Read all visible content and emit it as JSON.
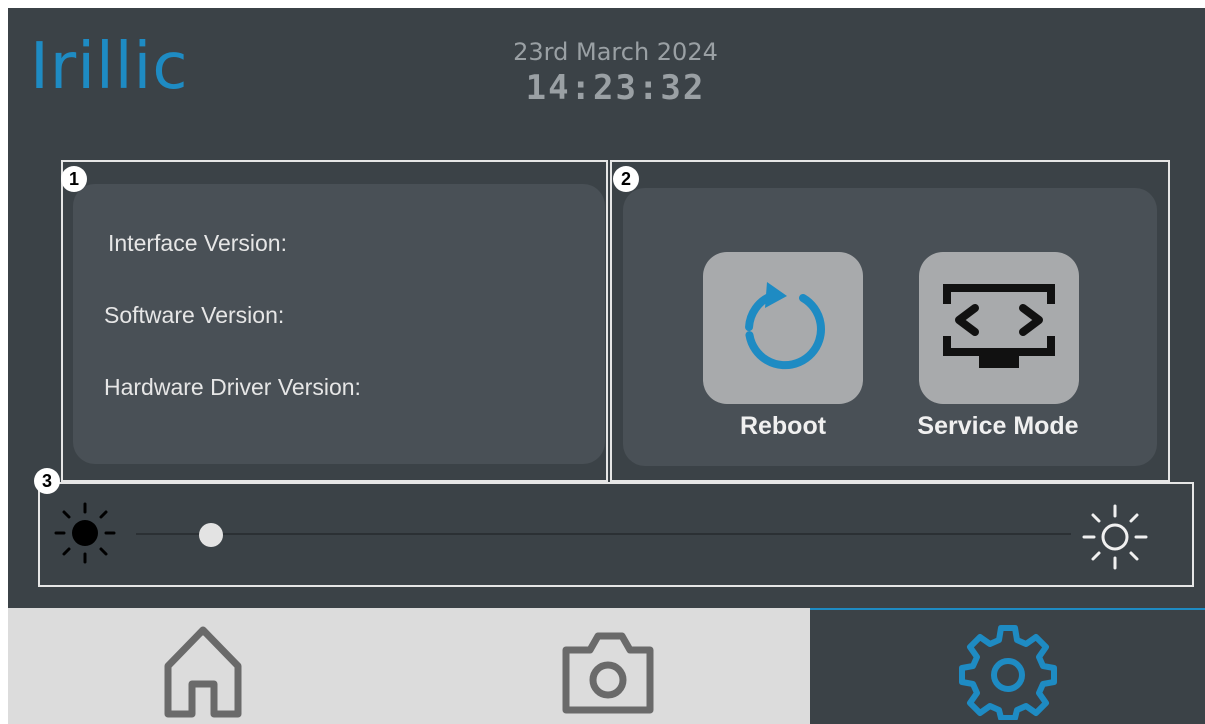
{
  "header": {
    "logo_text": "Irillic",
    "date": "23rd March 2024",
    "time": "14:23:32"
  },
  "sections": {
    "info": {
      "number": "1",
      "labels": [
        "Interface Version:",
        "Software Version:",
        "Hardware Driver Version:"
      ]
    },
    "actions": {
      "number": "2",
      "reboot_label": "Reboot",
      "service_label": "Service Mode",
      "reboot_icon": "reboot-icon",
      "service_icon": "service-mode-icon"
    },
    "brightness": {
      "number": "3",
      "min_icon": "sun-dark-icon",
      "max_icon": "sun-light-icon",
      "level": 0.08
    }
  },
  "nav": {
    "items": [
      {
        "name": "home",
        "icon": "home-icon"
      },
      {
        "name": "camera",
        "icon": "camera-icon"
      },
      {
        "name": "settings",
        "icon": "gear-icon",
        "active": true
      }
    ]
  },
  "colors": {
    "accent": "#1e8bc3",
    "background": "#3b4247",
    "panel": "#495056",
    "nav_inactive": "#dcdcdc"
  }
}
